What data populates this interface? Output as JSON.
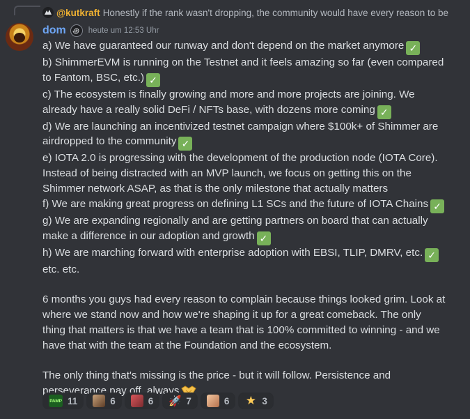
{
  "reply": {
    "author": "@kutkraft",
    "text": "Honestly if the rank wasn't dropping, the community would have every reason to be"
  },
  "message": {
    "author": "dom",
    "timestamp": "heute um 12:53 Uhr",
    "author_color": "#6ea6f5",
    "lines": [
      {
        "text": "a) We have guaranteed our runway and don't depend on the market anymore",
        "check": true
      },
      {
        "text": "b) ShimmerEVM is running on the Testnet and it feels amazing so far (even compared",
        "check": false
      },
      {
        "text": "to Fantom, BSC, etc.)",
        "check": true
      },
      {
        "text": "c) The ecosystem is finally growing and more and more projects are joining. We",
        "check": false
      },
      {
        "text": "already have a really solid DeFi / NFTs base, with dozens more coming",
        "check": true
      },
      {
        "text": "d) We are launching an incentivized testnet campaign where $100k+ of Shimmer are",
        "check": false
      },
      {
        "text": "airdropped to the community",
        "check": true
      },
      {
        "text": "e) IOTA 2.0 is progressing with the development of the production node (IOTA Core).",
        "check": false
      },
      {
        "text": "Instead of being distracted with an MVP launch, we focus on getting this on the",
        "check": false
      },
      {
        "text": "Shimmer network ASAP, as that is the only milestone that actually matters",
        "check": false
      },
      {
        "text": "f) We are making great progress on defining L1 SCs and the future of IOTA Chains",
        "check": true
      },
      {
        "text": "g) We are expanding regionally and are getting partners on board that can actually",
        "check": false
      },
      {
        "text": "make a difference in our adoption and growth",
        "check": true
      },
      {
        "text": "h) We are marching forward with enterprise adoption with EBSI, TLIP, DMRV, etc.",
        "check": true
      },
      {
        "text": "etc. etc.",
        "check": false
      }
    ],
    "paragraph2": [
      "6 months you guys had every reason to complain because things looked grim. Look at",
      "where we stand now and how we're shaping it up for a great comeback. The only",
      "thing that matters is that we have a team that is 100% committed to winning - and we",
      "have that with the team at the Foundation and the ecosystem."
    ],
    "paragraph3": [
      "The only thing that's missing is the price - but it will follow. Persistence and",
      "perseverance pay off, always"
    ],
    "check_glyph": "✓",
    "check_color": "#78b159"
  },
  "reactions": [
    {
      "icon": "pamp-emoji-icon",
      "label": "PAMP",
      "count": "11"
    },
    {
      "icon": "avatar-emoji-icon",
      "label": "",
      "count": "6"
    },
    {
      "icon": "red-emoji-icon",
      "label": "",
      "count": "6"
    },
    {
      "icon": "rocket-icon",
      "label": "🚀",
      "count": "7"
    },
    {
      "icon": "face-emoji-icon",
      "label": "",
      "count": "6"
    },
    {
      "icon": "star-icon",
      "label": "★",
      "count": "3"
    }
  ],
  "colors": {
    "background": "#313338",
    "text": "#dbdee1",
    "reply_author": "#f0b232"
  }
}
